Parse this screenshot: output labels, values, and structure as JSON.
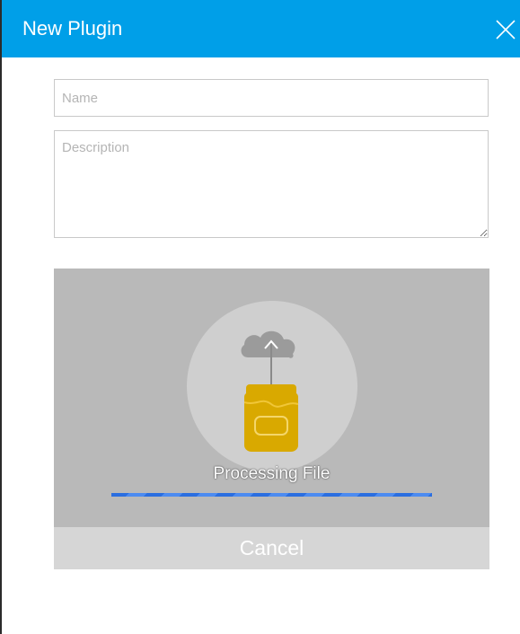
{
  "dialog": {
    "title": "New Plugin",
    "close_icon": "close-icon"
  },
  "form": {
    "name_placeholder": "Name",
    "name_value": "",
    "description_placeholder": "Description",
    "description_value": ""
  },
  "upload": {
    "status_text": "Processing File",
    "progress": 1.0,
    "icons": [
      "cloud-upload-icon",
      "jar-icon"
    ],
    "cancel_label": "Cancel"
  },
  "colors": {
    "title_bar": "#009fe8",
    "upload_zone": "#b9b9b9",
    "jar": "#d9a900",
    "progress": "#2b6fe0"
  }
}
